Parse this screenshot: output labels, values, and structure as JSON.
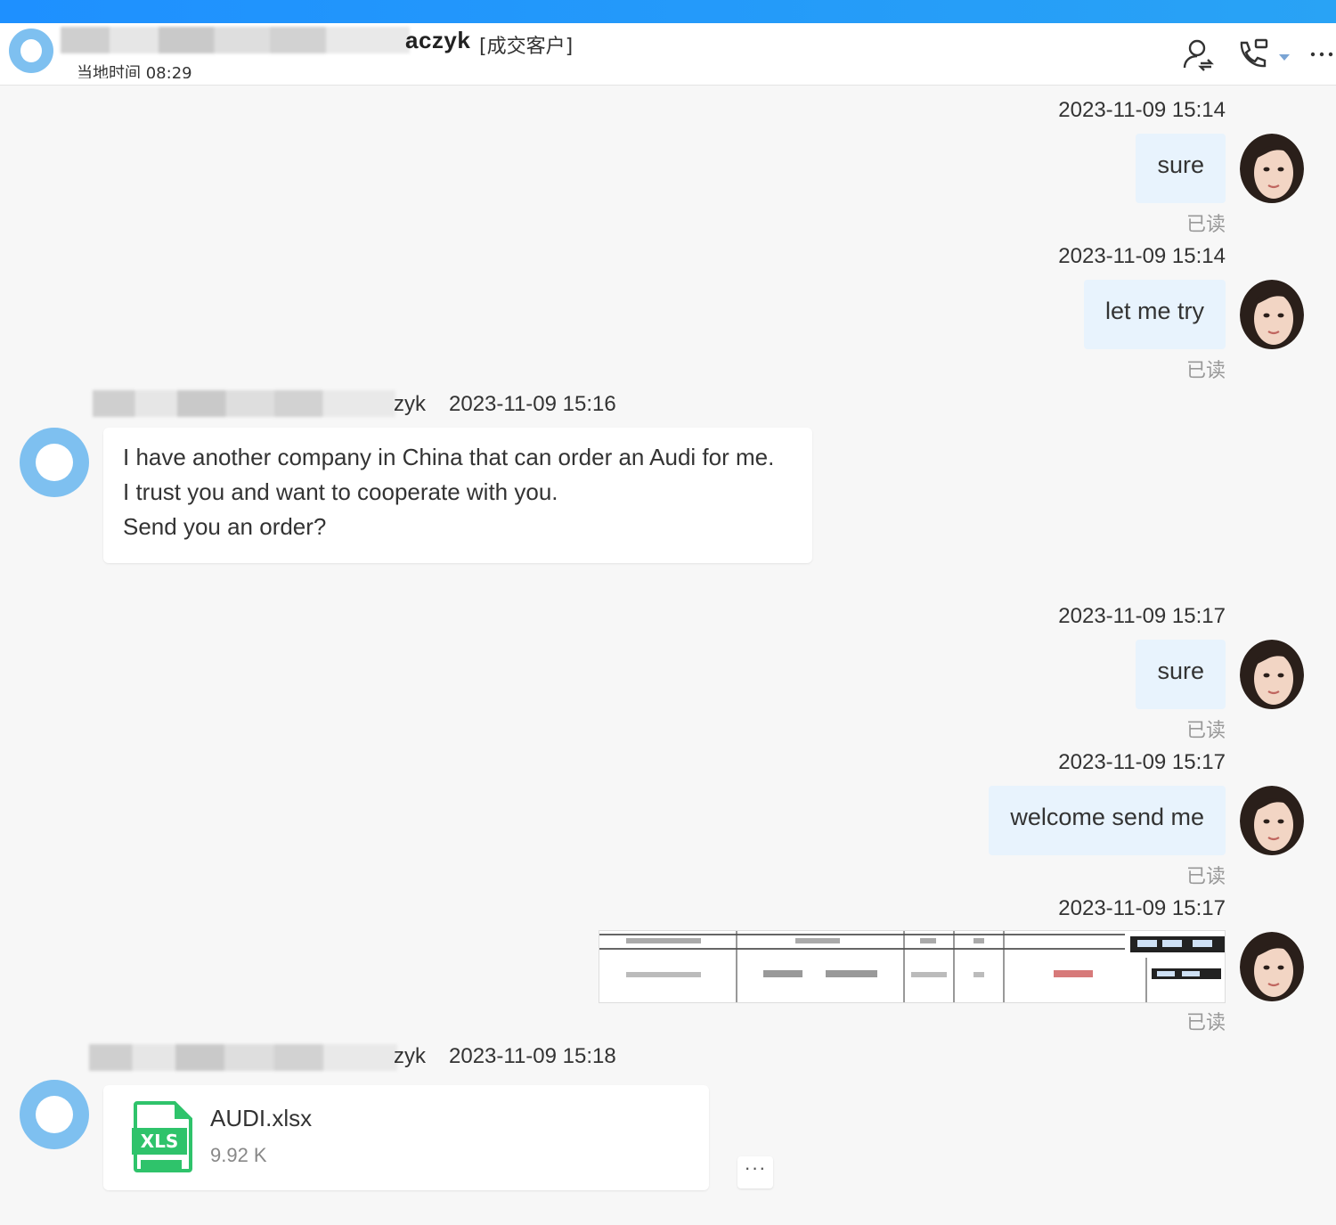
{
  "header": {
    "name": "aczyk",
    "tag": "[成交客户]",
    "local_time": "当地时间 08:29"
  },
  "messages": [
    {
      "id": 1,
      "direction": "out",
      "timestamp": "2023-11-09 15:14",
      "text": "sure",
      "status": "已读"
    },
    {
      "id": 2,
      "direction": "out",
      "timestamp": "2023-11-09 15:14",
      "text": "let me try",
      "status": "已读"
    },
    {
      "id": 3,
      "direction": "in",
      "sender": "zyk",
      "timestamp": "2023-11-09 15:16",
      "lines": [
        "I have another company in China that can order an Audi for me.",
        "I trust you and want to cooperate with you.",
        "Send you an order?"
      ]
    },
    {
      "id": 4,
      "direction": "out",
      "timestamp": "2023-11-09 15:17",
      "text": "sure",
      "status": "已读"
    },
    {
      "id": 5,
      "direction": "out",
      "timestamp": "2023-11-09 15:17",
      "text": "welcome send me",
      "status": "已读"
    },
    {
      "id": 6,
      "direction": "out",
      "timestamp": "2023-11-09 15:17",
      "type": "image",
      "status": "已读"
    },
    {
      "id": 7,
      "direction": "in",
      "sender": "zyk",
      "timestamp": "2023-11-09 15:18",
      "type": "file",
      "file": {
        "name": "AUDI.xlsx",
        "size": "9.92 K",
        "icon_label": "XLS"
      }
    }
  ],
  "more_actions_label": "···"
}
